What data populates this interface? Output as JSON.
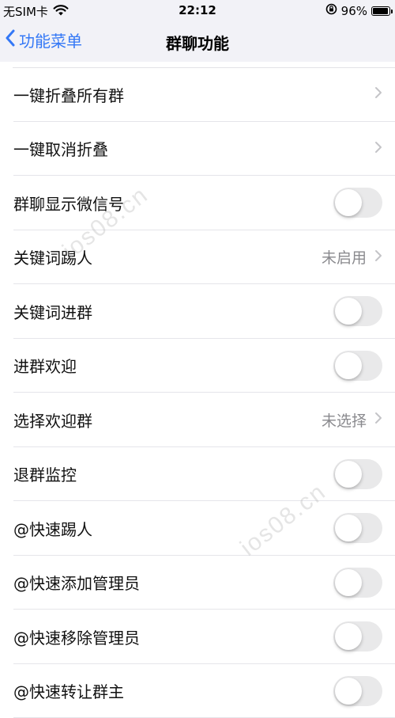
{
  "status_bar": {
    "carrier": "无SIM卡",
    "time": "22:12",
    "battery": "96%",
    "battery_level": 0.96
  },
  "nav": {
    "back_label": "功能菜单",
    "title": "群聊功能"
  },
  "rows": [
    {
      "label": "一键折叠所有群",
      "control": "chevron"
    },
    {
      "label": "一键取消折叠",
      "control": "chevron"
    },
    {
      "label": "群聊显示微信号",
      "control": "toggle",
      "on": false
    },
    {
      "label": "关键词踢人",
      "control": "chevron",
      "detail": "未启用"
    },
    {
      "label": "关键词进群",
      "control": "toggle",
      "on": false
    },
    {
      "label": "进群欢迎",
      "control": "toggle",
      "on": false
    },
    {
      "label": "选择欢迎群",
      "control": "chevron",
      "detail": "未选择"
    },
    {
      "label": "退群监控",
      "control": "toggle",
      "on": false
    },
    {
      "label": "@快速踢人",
      "control": "toggle",
      "on": false
    },
    {
      "label": "@快速添加管理员",
      "control": "toggle",
      "on": false
    },
    {
      "label": "@快速移除管理员",
      "control": "toggle",
      "on": false
    },
    {
      "label": "@快速转让群主",
      "control": "toggle",
      "on": false
    }
  ],
  "watermark": "ios08.cn",
  "colors": {
    "accent": "#3478f6",
    "toggle_off": "#e9e9ea",
    "secondary_text": "#8a8a8e"
  }
}
